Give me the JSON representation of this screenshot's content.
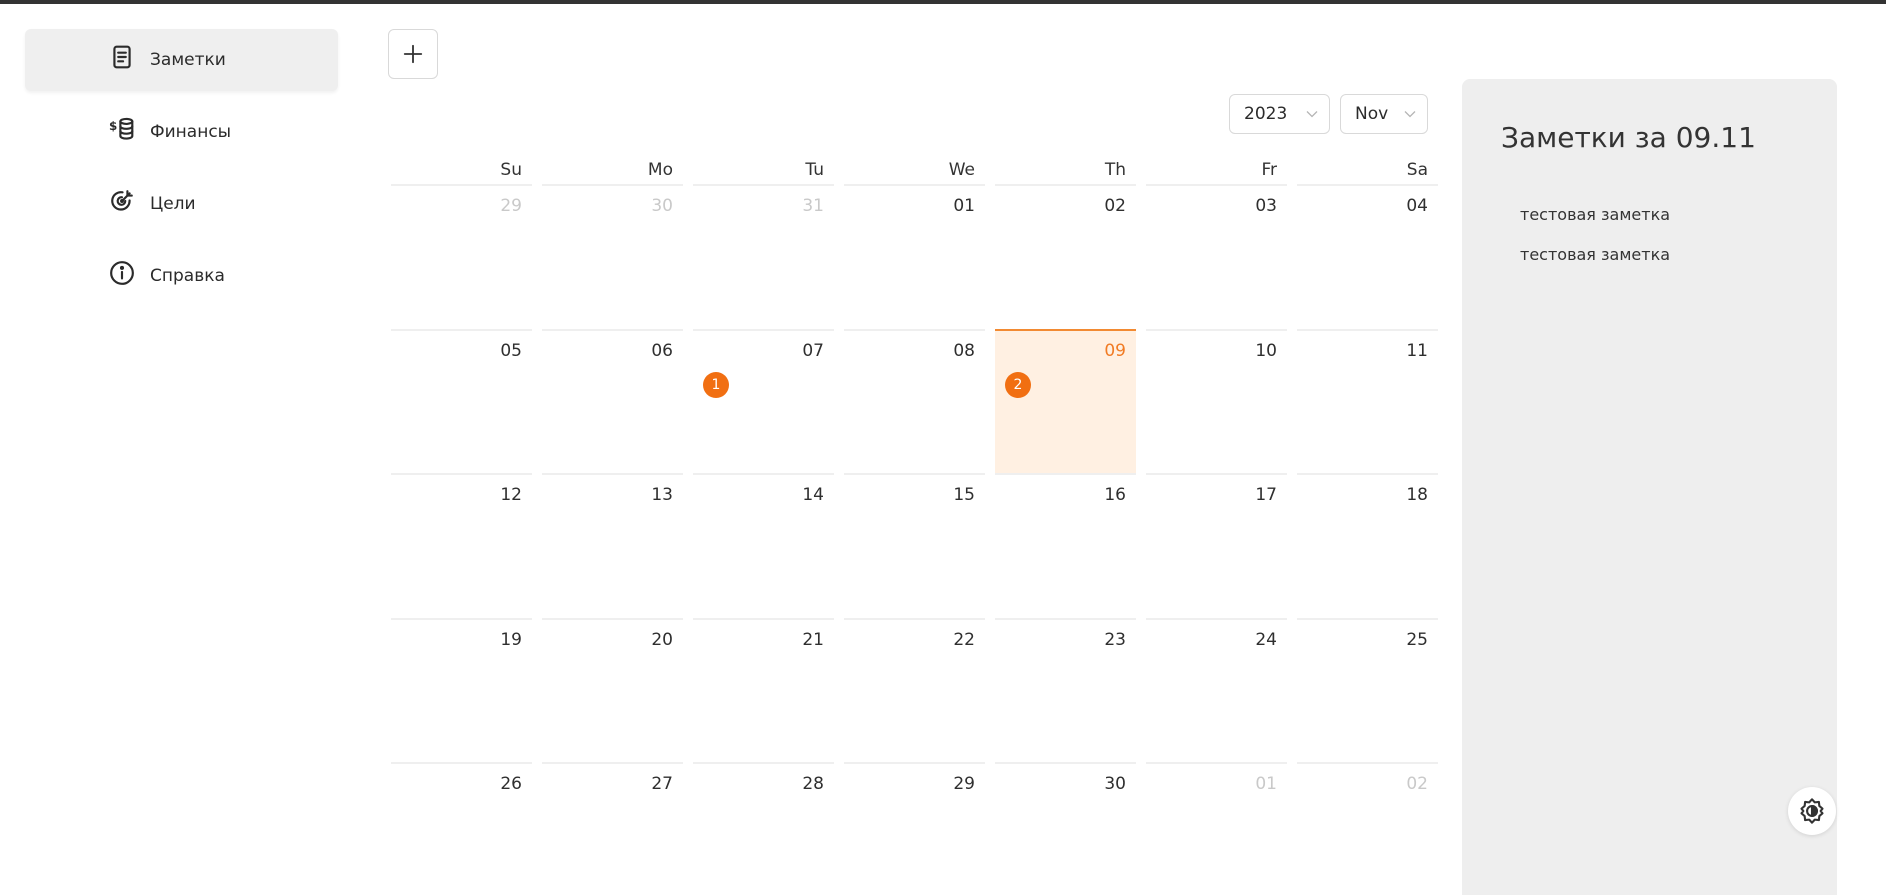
{
  "sidebar": {
    "items": [
      {
        "label": "Заметки",
        "icon": "notes-icon",
        "active": true
      },
      {
        "label": "Финансы",
        "icon": "coins-icon",
        "active": false
      },
      {
        "label": "Цели",
        "icon": "target-icon",
        "active": false
      },
      {
        "label": "Справка",
        "icon": "info-icon",
        "active": false
      }
    ]
  },
  "toolbar": {
    "add_icon": "plus-icon"
  },
  "filters": {
    "year": "2023",
    "month": "Nov"
  },
  "calendar": {
    "weekdays": [
      "Su",
      "Mo",
      "Tu",
      "We",
      "Th",
      "Fr",
      "Sa"
    ],
    "weeks": [
      [
        "29",
        "30",
        "31",
        "01",
        "02",
        "03",
        "04"
      ],
      [
        "05",
        "06",
        "07",
        "08",
        "09",
        "10",
        "11"
      ],
      [
        "12",
        "13",
        "14",
        "15",
        "16",
        "17",
        "18"
      ],
      [
        "19",
        "20",
        "21",
        "22",
        "23",
        "24",
        "25"
      ],
      [
        "26",
        "27",
        "28",
        "29",
        "30",
        "01",
        "02"
      ]
    ],
    "badges": {
      "w1_tu": "1",
      "w1_th": "2"
    },
    "selected": "09"
  },
  "notes_panel": {
    "title": "Заметки за 09.11",
    "items": [
      "тестовая заметка",
      "тестовая заметка"
    ]
  },
  "colors": {
    "accent": "#f16f12",
    "selected_bg": "#fff0e2",
    "panel_bg": "#eeeeee"
  },
  "settings": {
    "icon": "theme-settings-icon"
  }
}
